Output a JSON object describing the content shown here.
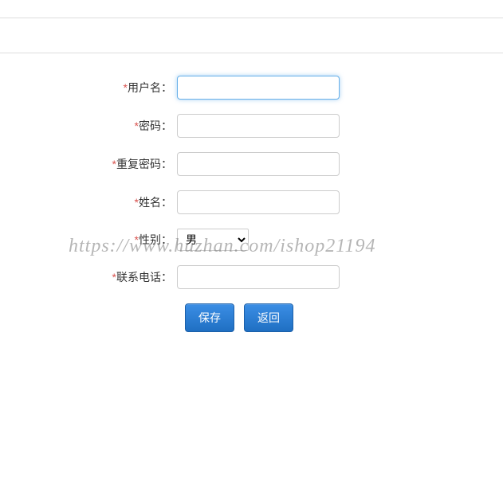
{
  "form": {
    "username": {
      "label": "用户名：",
      "value": ""
    },
    "password": {
      "label": "密码：",
      "value": ""
    },
    "repeat_password": {
      "label": "重复密码：",
      "value": ""
    },
    "name": {
      "label": "姓名：",
      "value": ""
    },
    "gender": {
      "label": "性别：",
      "selected": "男"
    },
    "phone": {
      "label": "联系电话：",
      "value": ""
    }
  },
  "required_mark": "*",
  "buttons": {
    "save": "保存",
    "back": "返回"
  },
  "watermark": "https://www.huzhan.com/ishop21194"
}
